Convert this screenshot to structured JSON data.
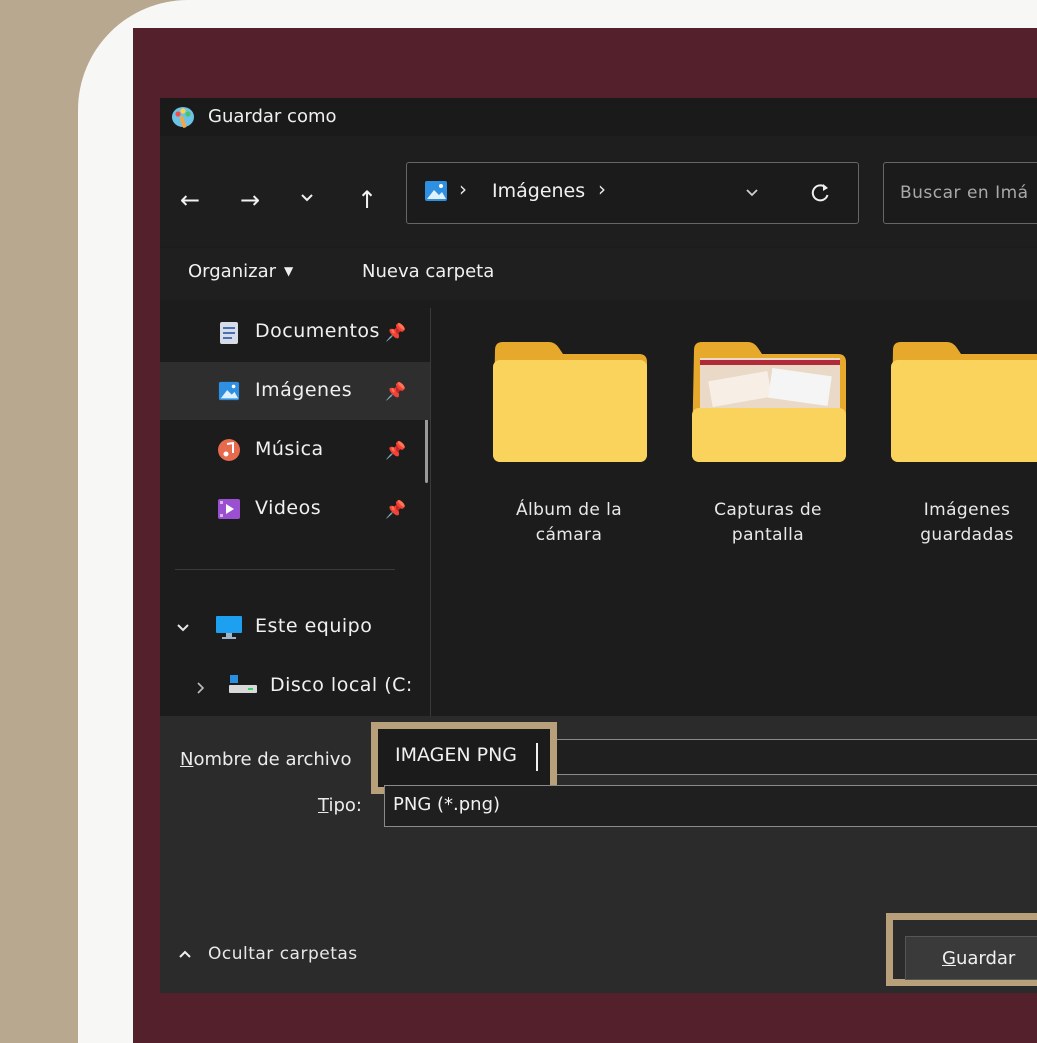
{
  "dialog": {
    "title": "Guardar como",
    "address": {
      "breadcrumb_location": "Imágenes",
      "separator_1": "›",
      "separator_2": "›"
    },
    "search": {
      "placeholder": "Buscar en Imá"
    },
    "command_bar": {
      "organize": "Organizar",
      "new_folder": "Nueva carpeta"
    },
    "sidebar": {
      "items": [
        {
          "label": "Documentos",
          "icon": "document-icon"
        },
        {
          "label": "Imágenes",
          "icon": "pictures-icon",
          "selected": true
        },
        {
          "label": "Música",
          "icon": "music-icon"
        },
        {
          "label": "Videos",
          "icon": "video-icon"
        }
      ],
      "this_pc": "Este equipo",
      "local_disk": "Disco local (C:"
    },
    "folders": [
      {
        "label": "Álbum de la\ncámara"
      },
      {
        "label": "Capturas de\npantalla"
      },
      {
        "label": "Imágenes\nguardadas"
      }
    ],
    "filename": {
      "label": "Nombre de archivo",
      "label_access_key": "N",
      "label_rest": "ombre de archivo",
      "value": "IMAGEN PNG"
    },
    "filetype": {
      "label": "Tipo:",
      "label_access_key": "T",
      "label_rest": "ipo:",
      "value": "PNG (*.png)"
    },
    "hide_folders": "Ocultar carpetas",
    "save_button": {
      "label": "Guardar",
      "access_key": "G",
      "rest": "uardar"
    }
  },
  "colors": {
    "background_outer": "#b8a88f",
    "card": "#f7f7f6",
    "frame": "#53202b",
    "dialog_dark": "#1c1c1c",
    "highlight_box": "#b8a07a",
    "folder_yellow": "#f9d35c"
  }
}
